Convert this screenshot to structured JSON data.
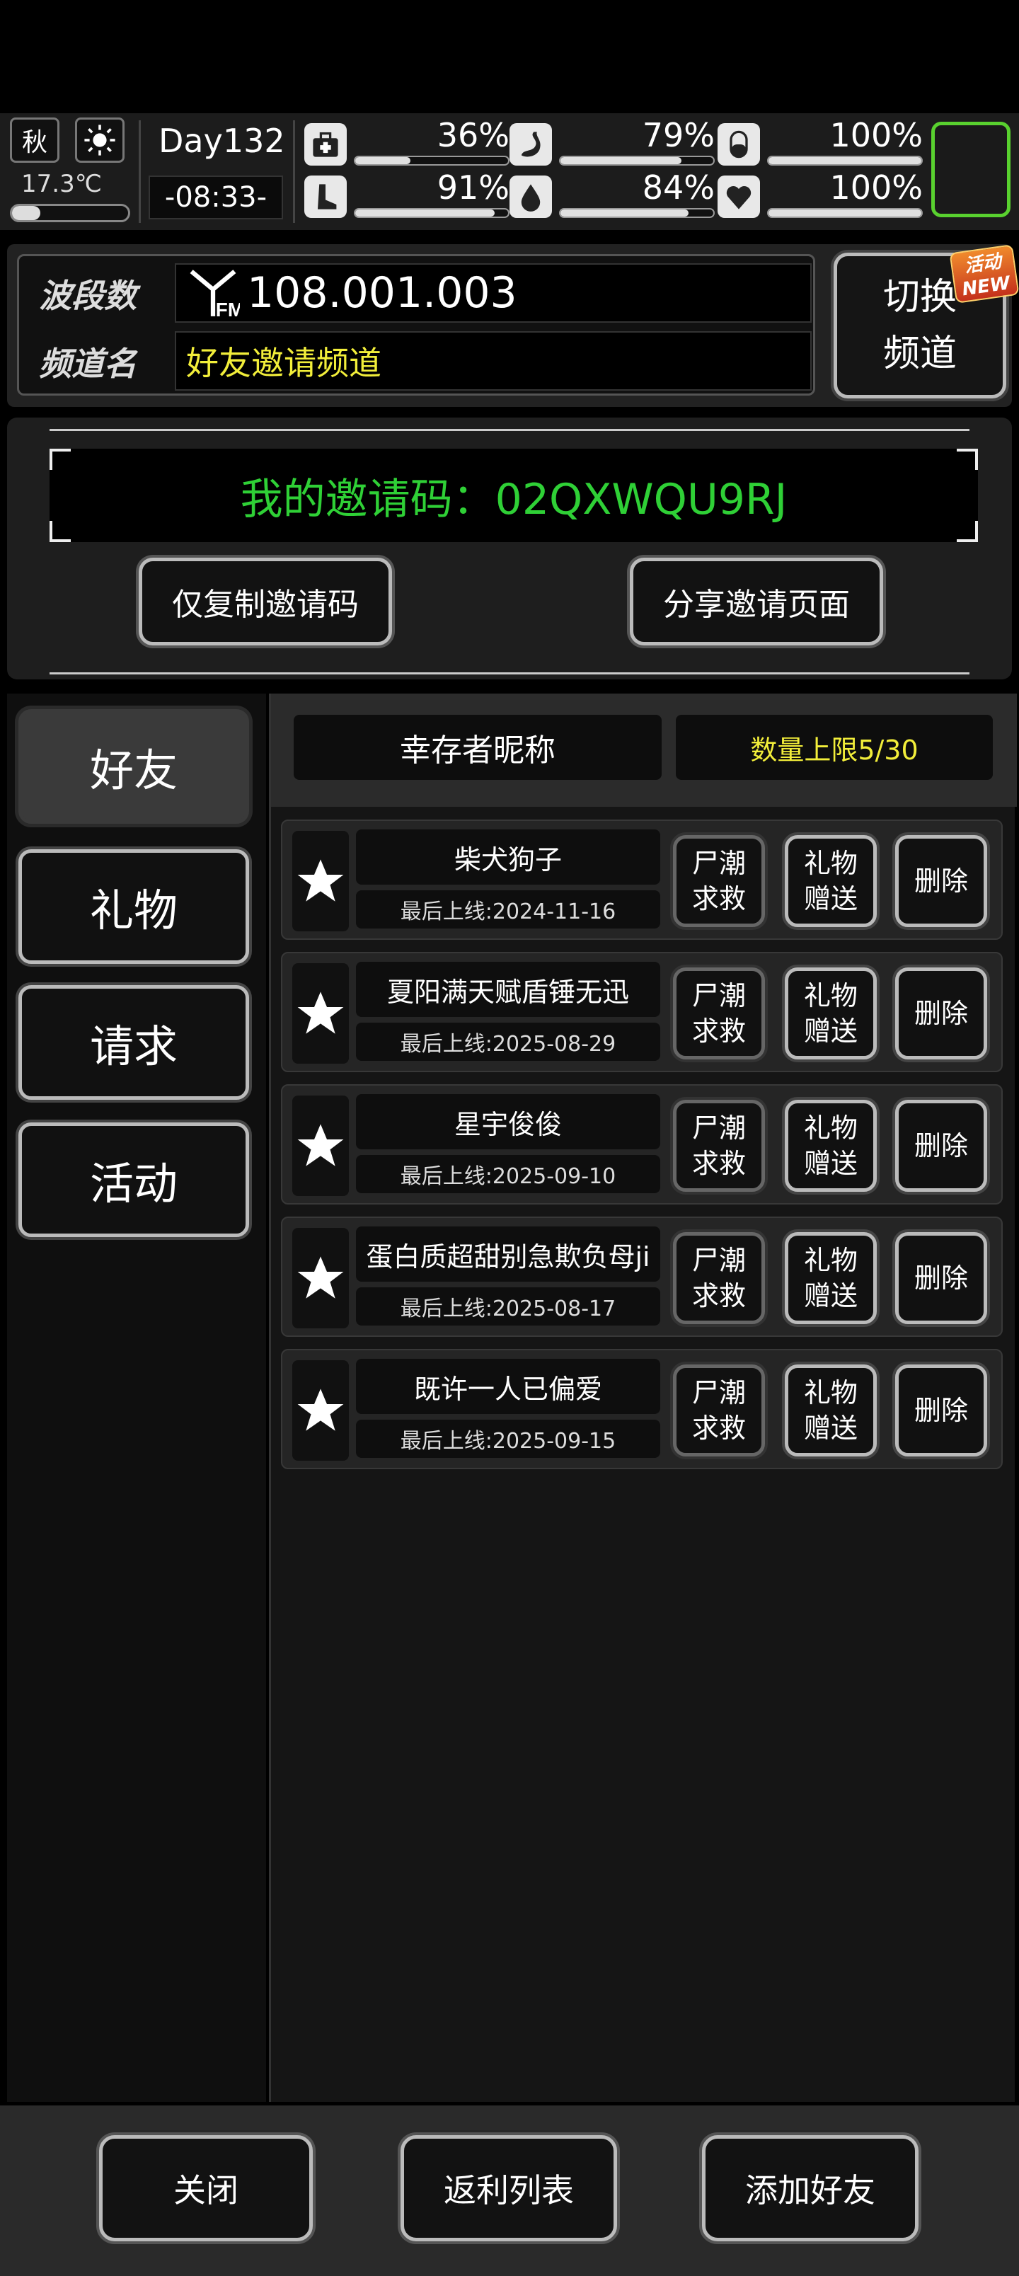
{
  "status": {
    "season": "秋",
    "temperature": "17.3℃",
    "day": "Day132",
    "time": "-08:33-",
    "stats": [
      {
        "icon": "medkit-icon",
        "percent": "36%",
        "level": 0.36
      },
      {
        "icon": "stomach-icon",
        "percent": "79%",
        "level": 0.79
      },
      {
        "icon": "pill-icon",
        "percent": "100%",
        "level": 1.0
      },
      {
        "icon": "leg-icon",
        "percent": "91%",
        "level": 0.91
      },
      {
        "icon": "water-drop-icon",
        "percent": "84%",
        "level": 0.84
      },
      {
        "icon": "heart-icon",
        "percent": "100%",
        "level": 1.0
      }
    ]
  },
  "channel": {
    "band_label": "波段数",
    "band_value": "108.001.003",
    "name_label": "频道名",
    "name_value": "好友邀请频道",
    "switch_label_line1": "切换",
    "switch_label_line2": "频道",
    "badge_line1": "活动",
    "badge_line2": "NEW"
  },
  "invite": {
    "code_text": "我的邀请码：02QXWQU9RJ",
    "copy_button": "仅复制邀请码",
    "share_button": "分享邀请页面"
  },
  "tabs": [
    "好友",
    "礼物",
    "请求",
    "活动"
  ],
  "list": {
    "nickname_header": "幸存者昵称",
    "limit_text": "数量上限5/30",
    "friends": [
      {
        "name": "柴犬狗子",
        "last_online": "最后上线:2024-11-16"
      },
      {
        "name": "夏阳满天赋盾锤无迅",
        "last_online": "最后上线:2025-08-29"
      },
      {
        "name": "星宇俊俊",
        "last_online": "最后上线:2025-09-10"
      },
      {
        "name": "蛋白质超甜别急欺负母ji",
        "last_online": "最后上线:2025-08-17"
      },
      {
        "name": "既许一人已偏爱",
        "last_online": "最后上线:2025-09-15"
      }
    ],
    "rescue_l1": "尸潮",
    "rescue_l2": "求救",
    "gift_l1": "礼物",
    "gift_l2": "赠送",
    "delete": "删除"
  },
  "bottom": {
    "close": "关闭",
    "rebate": "返利列表",
    "add_friend": "添加好友"
  },
  "colors": {
    "accent_green": "#2fd036",
    "accent_yellow": "#f2ee3a",
    "slot_green": "#59d12f"
  }
}
